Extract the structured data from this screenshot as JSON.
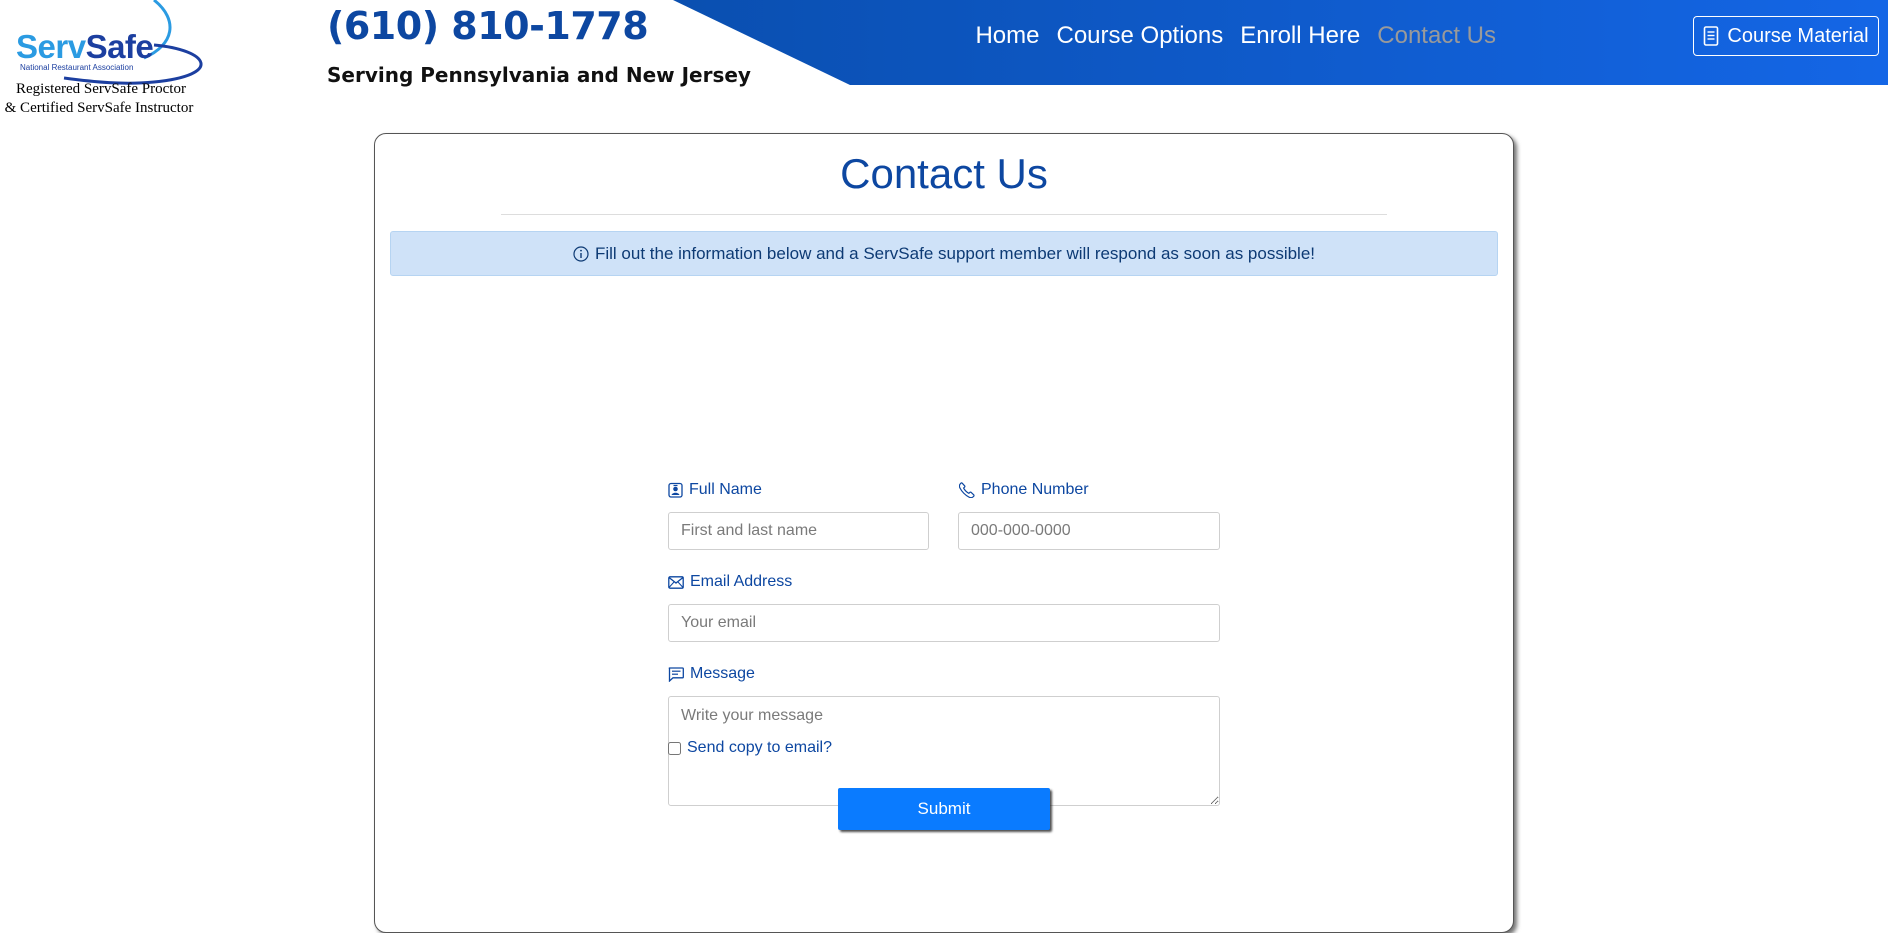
{
  "header": {
    "logo": {
      "serv": "Serv",
      "safe": "Safe",
      "sub": "National Restaurant Association",
      "line1": "Registered ServSafe Proctor",
      "line2": "& Certified ServSafe Instructor"
    },
    "phone": "(610) 810-1778",
    "serving": "Serving Pennsylvania and New Jersey",
    "nav": [
      {
        "label": "Home"
      },
      {
        "label": "Course Options"
      },
      {
        "label": "Enroll Here"
      },
      {
        "label": "Contact Us",
        "active": true
      }
    ],
    "course_material_label": "Course Material"
  },
  "contact": {
    "title": "Contact Us",
    "alert": "Fill out the information below and a ServSafe support member will respond as soon as possible!",
    "full_name": {
      "label": "Full Name",
      "placeholder": "First and last name",
      "value": ""
    },
    "phone": {
      "label": "Phone Number",
      "placeholder": "000-000-0000",
      "value": ""
    },
    "email": {
      "label": "Email Address",
      "placeholder": "Your email",
      "value": ""
    },
    "message": {
      "label": "Message",
      "placeholder": "Write your message",
      "value": ""
    },
    "send_copy": {
      "label": "Send copy to email?",
      "checked": false
    },
    "submit_label": "Submit"
  },
  "colors": {
    "brand_blue": "#0d47a1",
    "header_gradient_start": "#0a4fb0",
    "header_gradient_end": "#1466e6",
    "button_blue": "#0a7bff",
    "alert_bg": "#cfe2f8",
    "nav_active": "#9a9a9a"
  },
  "icons": [
    "person-badge-icon",
    "telephone-icon",
    "envelope-icon",
    "chat-text-icon",
    "info-circle-icon",
    "document-icon"
  ]
}
